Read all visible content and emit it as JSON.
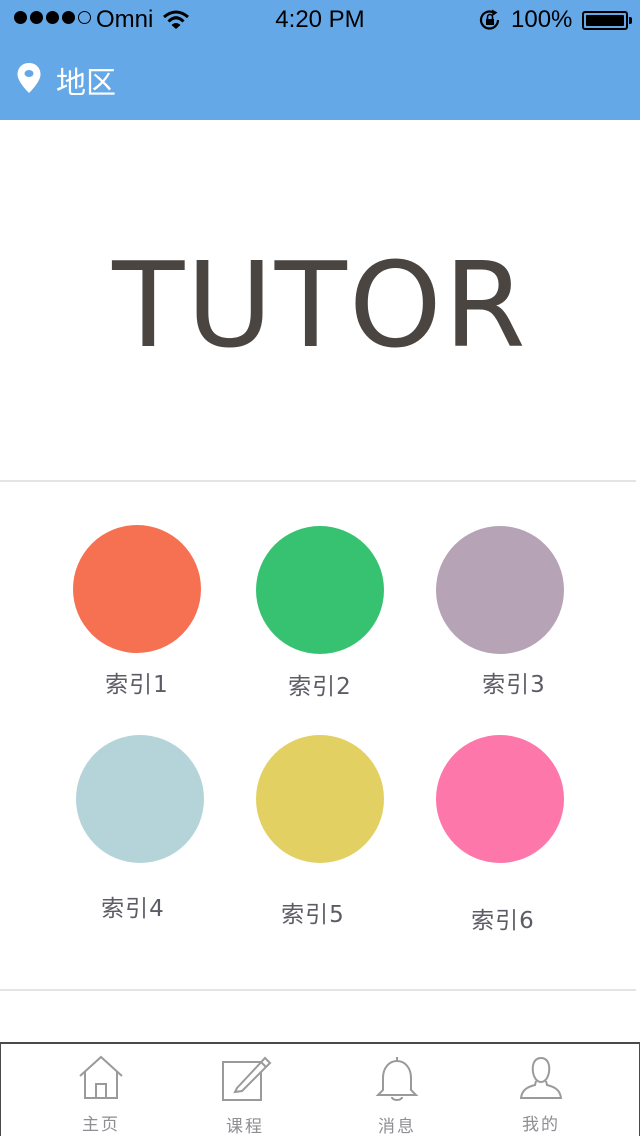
{
  "status_bar": {
    "carrier": "Omni",
    "time": "4:20 PM",
    "battery": "100%"
  },
  "nav": {
    "location_label": "地区",
    "location_icon": "location-pin-icon"
  },
  "hero": {
    "title": "TUTOR"
  },
  "categories": [
    {
      "label": "索引1",
      "color": "#f67052"
    },
    {
      "label": "索引2",
      "color": "#37c271"
    },
    {
      "label": "索引3",
      "color": "#b6a3b6"
    },
    {
      "label": "索引4",
      "color": "#b5d4da"
    },
    {
      "label": "索引5",
      "color": "#e2d063"
    },
    {
      "label": "索引6",
      "color": "#fe77ab"
    }
  ],
  "tabs": [
    {
      "label": "主页",
      "icon": "home-icon"
    },
    {
      "label": "课程",
      "icon": "edit-icon"
    },
    {
      "label": "消息",
      "icon": "bell-icon"
    },
    {
      "label": "我的",
      "icon": "user-icon"
    }
  ],
  "colors": {
    "header_blue": "#64a8e8",
    "hero_text": "#4a4541",
    "tab_gray": "#8e8e93"
  }
}
